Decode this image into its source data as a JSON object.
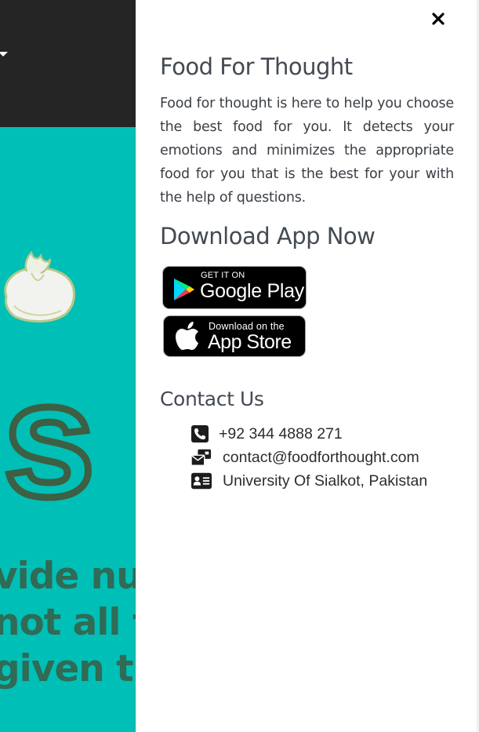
{
  "background": {
    "hero_word": "ds",
    "hero_lines": [
      "vide nu",
      "not all f",
      "given tin"
    ],
    "colors": {
      "header": "#252525",
      "hero": "#00bfb6",
      "text": "#2f6b55"
    }
  },
  "sidebar": {
    "close_icon": "close-icon",
    "title": "Food For Thought",
    "about": "Food for thought is here to help you choose the best food for you. It detects your emotions and minimizes the appropriate food for you that is the best for your with the help of questions.",
    "download_heading": "Download App Now",
    "badges": {
      "google_play": {
        "small": "GET IT ON",
        "big": "Google Play",
        "icon": "google-play-icon"
      },
      "app_store": {
        "small": "Download on the",
        "big": "App Store",
        "icon": "apple-icon"
      }
    },
    "contact_heading": "Contact Us",
    "contact": {
      "phone": {
        "icon": "phone-icon",
        "text": "+92 344 4888 271"
      },
      "email": {
        "icon": "envelope-icon",
        "text": "contact@foodforthought.com"
      },
      "address": {
        "icon": "address-card-icon",
        "text": "University Of Sialkot, Pakistan"
      }
    }
  }
}
